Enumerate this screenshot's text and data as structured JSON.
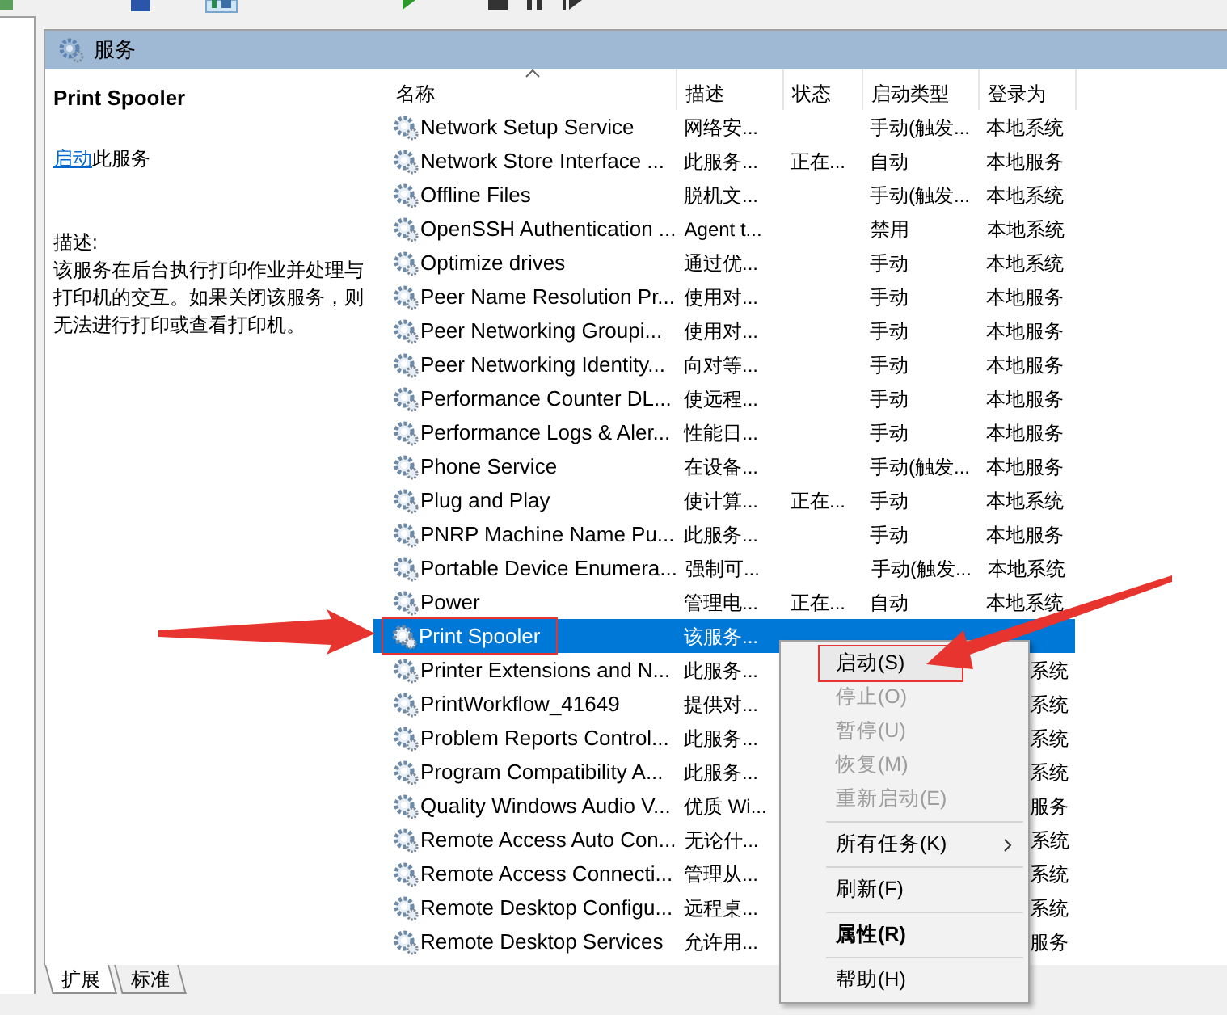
{
  "panel_title": "服务",
  "details": {
    "service_name": "Print Spooler",
    "action_link": "启动",
    "action_text": "此服务",
    "description_label": "描述:",
    "description": "该服务在后台执行打印作业并处理与打印机的交互。如果关闭该服务，则无法进行打印或查看打印机。"
  },
  "table": {
    "columns": [
      {
        "label": "名称",
        "sorted": true
      },
      {
        "label": "描述",
        "sorted": false
      },
      {
        "label": "状态",
        "sorted": false
      },
      {
        "label": "启动类型",
        "sorted": false
      },
      {
        "label": "登录为",
        "sorted": false
      }
    ],
    "rows": [
      {
        "name": "Network Setup Service",
        "description": "网络安...",
        "status": "",
        "startup": "手动(触发...",
        "logon": "本地系统",
        "selected": false
      },
      {
        "name": "Network Store Interface ...",
        "description": "此服务...",
        "status": "正在...",
        "startup": "自动",
        "logon": "本地服务",
        "selected": false
      },
      {
        "name": "Offline Files",
        "description": "脱机文...",
        "status": "",
        "startup": "手动(触发...",
        "logon": "本地系统",
        "selected": false
      },
      {
        "name": "OpenSSH Authentication ...",
        "description": "Agent t...",
        "status": "",
        "startup": "禁用",
        "logon": "本地系统",
        "selected": false
      },
      {
        "name": "Optimize drives",
        "description": "通过优...",
        "status": "",
        "startup": "手动",
        "logon": "本地系统",
        "selected": false
      },
      {
        "name": "Peer Name Resolution Pr...",
        "description": "使用对...",
        "status": "",
        "startup": "手动",
        "logon": "本地服务",
        "selected": false
      },
      {
        "name": "Peer Networking Groupi...",
        "description": "使用对...",
        "status": "",
        "startup": "手动",
        "logon": "本地服务",
        "selected": false
      },
      {
        "name": "Peer Networking Identity...",
        "description": "向对等...",
        "status": "",
        "startup": "手动",
        "logon": "本地服务",
        "selected": false
      },
      {
        "name": "Performance Counter DL...",
        "description": "使远程...",
        "status": "",
        "startup": "手动",
        "logon": "本地服务",
        "selected": false
      },
      {
        "name": "Performance Logs & Aler...",
        "description": "性能日...",
        "status": "",
        "startup": "手动",
        "logon": "本地服务",
        "selected": false
      },
      {
        "name": "Phone Service",
        "description": "在设备...",
        "status": "",
        "startup": "手动(触发...",
        "logon": "本地服务",
        "selected": false
      },
      {
        "name": "Plug and Play",
        "description": "使计算...",
        "status": "正在...",
        "startup": "手动",
        "logon": "本地系统",
        "selected": false
      },
      {
        "name": "PNRP Machine Name Pu...",
        "description": "此服务...",
        "status": "",
        "startup": "手动",
        "logon": "本地服务",
        "selected": false
      },
      {
        "name": "Portable Device Enumera...",
        "description": "强制可...",
        "status": "",
        "startup": "手动(触发...",
        "logon": "本地系统",
        "selected": false
      },
      {
        "name": "Power",
        "description": "管理电...",
        "status": "正在...",
        "startup": "自动",
        "logon": "本地系统",
        "selected": false
      },
      {
        "name": "Print Spooler",
        "description": "该服务...",
        "status": "",
        "selected": true,
        "highlighted": true
      },
      {
        "name": "Printer Extensions and N...",
        "description": "此服务...",
        "logon": "系统",
        "selected": false,
        "under_menu": true
      },
      {
        "name": "PrintWorkflow_41649",
        "description": "提供对...",
        "logon": "系统",
        "selected": false,
        "under_menu": true
      },
      {
        "name": "Problem Reports Control...",
        "description": "此服务...",
        "logon": "系统",
        "selected": false,
        "under_menu": true
      },
      {
        "name": "Program Compatibility A...",
        "description": "此服务...",
        "logon": "系统",
        "selected": false,
        "under_menu": true
      },
      {
        "name": "Quality Windows Audio V...",
        "description": "优质 Wi...",
        "logon": "服务",
        "selected": false,
        "under_menu": true
      },
      {
        "name": "Remote Access Auto Con...",
        "description": "无论什...",
        "logon": "系统",
        "selected": false,
        "under_menu": true
      },
      {
        "name": "Remote Access Connecti...",
        "description": "管理从...",
        "logon": "系统",
        "selected": false,
        "under_menu": true
      },
      {
        "name": "Remote Desktop Configu...",
        "description": "远程桌...",
        "logon": "系统",
        "selected": false,
        "under_menu": true
      },
      {
        "name": "Remote Desktop Services",
        "description": "允许用...",
        "logon": "服务",
        "selected": false,
        "under_menu": true
      }
    ]
  },
  "context_menu": {
    "items": [
      {
        "kind": "item",
        "label": "启动(S)",
        "disabled": false,
        "highlighted": true
      },
      {
        "kind": "item",
        "label": "停止(O)",
        "disabled": true
      },
      {
        "kind": "item",
        "label": "暂停(U)",
        "disabled": true
      },
      {
        "kind": "item",
        "label": "恢复(M)",
        "disabled": true
      },
      {
        "kind": "item",
        "label": "重新启动(E)",
        "disabled": true
      },
      {
        "kind": "separator"
      },
      {
        "kind": "item",
        "label": "所有任务(K)",
        "disabled": false,
        "submenu": true
      },
      {
        "kind": "separator"
      },
      {
        "kind": "item",
        "label": "刷新(F)",
        "disabled": false
      },
      {
        "kind": "separator"
      },
      {
        "kind": "item",
        "label": "属性(R)",
        "disabled": false,
        "default": true
      },
      {
        "kind": "separator"
      },
      {
        "kind": "item",
        "label": "帮助(H)",
        "disabled": false
      }
    ]
  },
  "bottom_tabs": [
    {
      "label": "扩展",
      "selected": true
    },
    {
      "label": "标准",
      "selected": false
    }
  ]
}
